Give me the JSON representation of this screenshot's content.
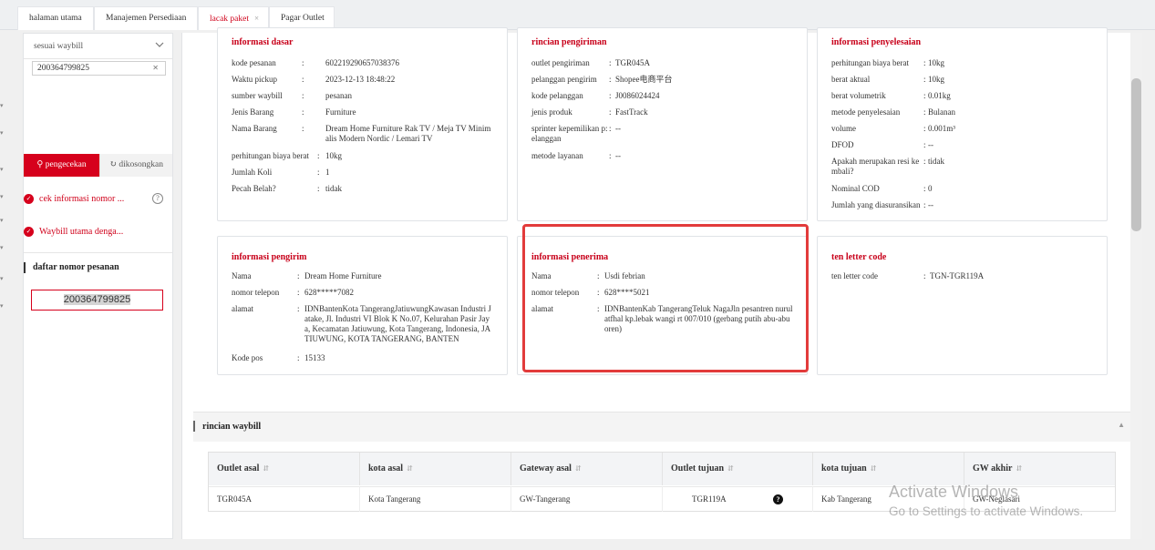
{
  "tabs": [
    {
      "label": "halaman utama"
    },
    {
      "label": "Manajemen Persediaan"
    },
    {
      "label": "lacak paket",
      "close": "×"
    },
    {
      "label": "Pagar Outlet"
    }
  ],
  "sidebar": {
    "select_value": "sesuai waybill",
    "waybill_input": "200364799825",
    "search_button": "pengecekan",
    "clear_button": "dikosongkan",
    "check_info": "cek informasi nomor ...",
    "main_waybill": "Waybill utama denga...",
    "order_list_title": "daftar nomor pesanan",
    "order_number": "200364799825"
  },
  "basic_info": {
    "title": "informasi dasar",
    "rows": [
      {
        "k": "kode pesanan",
        "v": "602219290657038376"
      },
      {
        "k": "Waktu pickup",
        "v": "2023-12-13 18:48:22"
      },
      {
        "k": "sumber waybill",
        "v": "pesanan"
      },
      {
        "k": "Jenis Barang",
        "v": "Furniture"
      },
      {
        "k": "Nama Barang",
        "v": "Dream Home Furniture Rak TV / Meja TV Minim alis Modern Nordic / Lemari TV"
      },
      {
        "k": "perhitungan biaya berat",
        "v": "10kg"
      },
      {
        "k": "Jumlah Koli",
        "v": "1"
      },
      {
        "k": "Pecah Belah?",
        "v": "tidak"
      }
    ]
  },
  "shipping_detail": {
    "title": "rincian pengiriman",
    "rows": [
      {
        "k": "outlet pengiriman",
        "v": "TGR045A"
      },
      {
        "k": "pelanggan pengirim",
        "v": "Shopee电商平台"
      },
      {
        "k": "kode pelanggan",
        "v": "J0086024424"
      },
      {
        "k": "jenis produk",
        "v": "FastTrack"
      },
      {
        "k": "sprinter kepemilikan p: elanggan",
        "v": "--"
      },
      {
        "k": "metode layanan",
        "v": "--"
      }
    ]
  },
  "settlement_info": {
    "title": "informasi penyelesaian",
    "rows": [
      {
        "k": "perhitungan biaya berat",
        "v": "10kg"
      },
      {
        "k": "berat aktual",
        "v": "10kg"
      },
      {
        "k": "berat volumetrik",
        "v": "0.01kg"
      },
      {
        "k": "metode penyelesaian",
        "v": "Bulanan"
      },
      {
        "k": "volume",
        "v": "0.001m³"
      },
      {
        "k": "DFOD",
        "v": "--"
      },
      {
        "k": "Apakah merupakan resi ke mbali?",
        "v": "tidak"
      },
      {
        "k": "Nominal COD",
        "v": "0"
      },
      {
        "k": "Jumlah yang diasuransikan",
        "v": "--"
      }
    ]
  },
  "sender_info": {
    "title": "informasi pengirim",
    "rows": [
      {
        "k": "Nama",
        "v": "Dream Home Furniture"
      },
      {
        "k": "nomor telepon",
        "v": "628*****7082"
      },
      {
        "k": "alamat",
        "v": "IDNBantenKota TangerangJatiuwungKawasan Industri J atake, Jl. Industri VI Blok K No.07, Kelurahan Pasir Jay a, Kecamatan Jatiuwung, Kota Tangerang, Indonesia, JA TIUWUNG, KOTA TANGERANG, BANTEN"
      },
      {
        "k": "Kode pos",
        "v": "15133"
      }
    ]
  },
  "receiver_info": {
    "title": "informasi penerima",
    "rows": [
      {
        "k": "Nama",
        "v": "Usdi febrian"
      },
      {
        "k": "nomor telepon",
        "v": "628****5021"
      },
      {
        "k": "alamat",
        "v": "IDNBantenKab TangerangTeluk NagaJln pesantren nurul atfhal kp.lebak wangi rt 007/010 (gerbang putih abu-abu oren)"
      }
    ]
  },
  "ten_letter": {
    "title": "ten letter code",
    "rows": [
      {
        "k": "ten letter code",
        "v": "TGN-TGR119A"
      }
    ]
  },
  "waybill_detail": {
    "title": "rincian waybill",
    "columns": [
      "Outlet asal",
      "kota asal",
      "Gateway asal",
      "Outlet tujuan",
      "kota tujuan",
      "GW akhir"
    ],
    "row": [
      "TGR045A",
      "Kota Tangerang",
      "GW-Tangerang",
      "TGR119A",
      "Kab Tangerang",
      "GW-Neglasari"
    ],
    "help_icon": "?"
  },
  "os_watermark": {
    "line1": "Activate Windows",
    "line2": "Go to Settings to activate Windows."
  },
  "colors": {
    "accent": "#d6001c",
    "highlight": "#e23b3b"
  }
}
